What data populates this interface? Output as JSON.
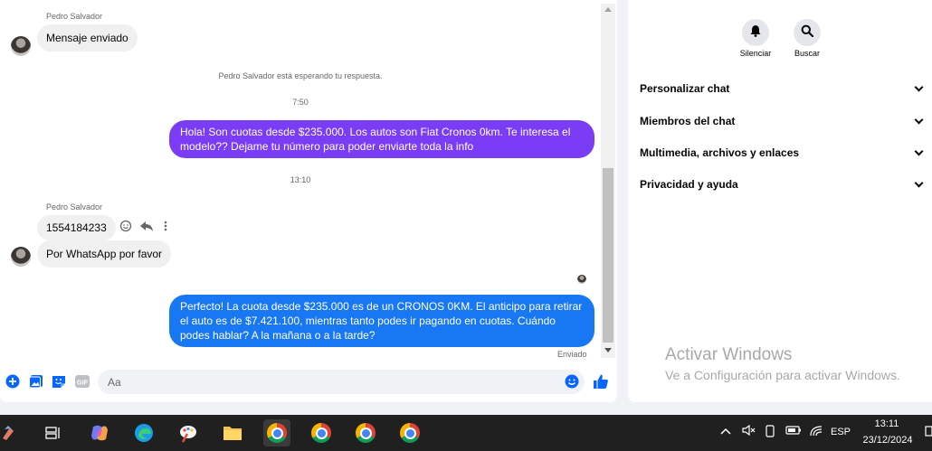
{
  "chat": {
    "sender_name_1": "Pedro Salvador",
    "msg_1": "Mensaje enviado",
    "waiting_notice": "Pedro Salvador está esperando tu respuesta.",
    "time_1": "7:50",
    "out_msg_1": "Hola! Son cuotas desde $235.000. Los autos son Fiat Cronos 0km. Te interesa el modelo?? Dejame tu número para poder enviarte toda la info",
    "time_2": "13:10",
    "sender_name_2": "Pedro Salvador",
    "msg_2": "1554184233",
    "msg_3": "Por WhatsApp por favor",
    "out_msg_2": "Perfecto! La cuota desde $235.000 es de un CRONOS 0KM. El anticipo para retirar el auto es de $7.421.100, mientras tanto podes ir pagando en cuotas. Cuándo podes hablar? A la mañana o a la tarde?",
    "status": "Enviado",
    "composer_placeholder": "Aa",
    "colors": {
      "outgoing_purple": "#7a3cf5",
      "outgoing_blue": "#1877f2",
      "accent": "#0866ff"
    }
  },
  "info": {
    "mute_label": "Silenciar",
    "search_label": "Buscar",
    "sections": [
      "Personalizar chat",
      "Miembros del chat",
      "Multimedia, archivos y enlaces",
      "Privacidad y ayuda"
    ]
  },
  "watermark": {
    "title": "Activar Windows",
    "subtitle": "Ve a Configuración para activar Windows."
  },
  "taskbar": {
    "language": "ESP",
    "time": "13:11",
    "date": "23/12/2024"
  }
}
